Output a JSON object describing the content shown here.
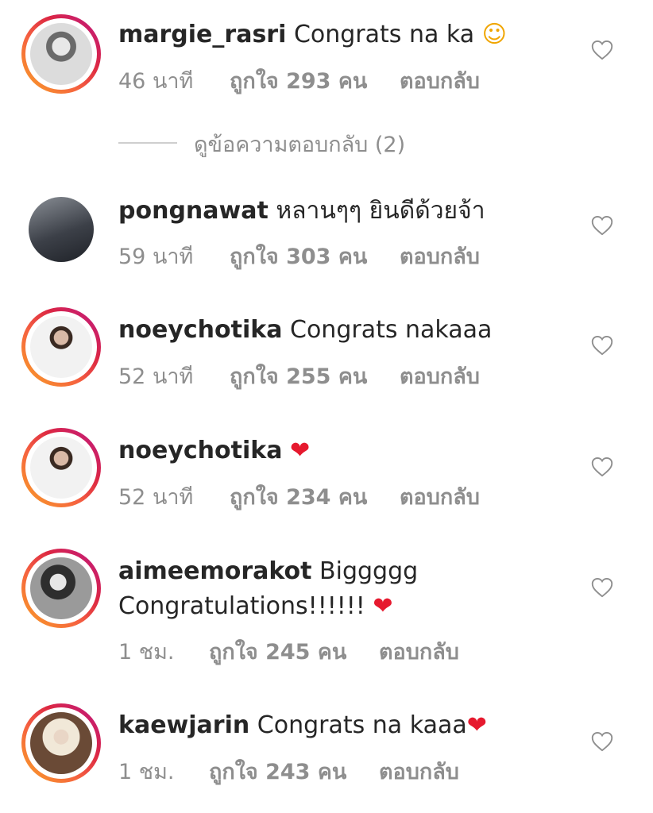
{
  "comments": [
    {
      "username": "margie_rasri",
      "text": "Congrats na ka",
      "emoji": "☺",
      "time": "46 นาที",
      "likes": "ถูกใจ 293 คน",
      "reply": "ตอบกลับ",
      "has_story_ring": true
    },
    {
      "username": "pongnawat",
      "text": "หลานๆๆ ยินดีด้วยจ้า",
      "emoji": "",
      "time": "59 นาที",
      "likes": "ถูกใจ 303 คน",
      "reply": "ตอบกลับ",
      "has_story_ring": false
    },
    {
      "username": "noeychotika",
      "text": "Congrats nakaaa",
      "emoji": "",
      "time": "52 นาที",
      "likes": "ถูกใจ 255 คน",
      "reply": "ตอบกลับ",
      "has_story_ring": true
    },
    {
      "username": "noeychotika",
      "text": "",
      "emoji": "❤",
      "time": "52 นาที",
      "likes": "ถูกใจ 234 คน",
      "reply": "ตอบกลับ",
      "has_story_ring": true
    },
    {
      "username": "aimeemorakot",
      "text": "Biggggg",
      "text_line2": "Congratulations!!!!!!",
      "emoji": "❤",
      "time": "1 ชม.",
      "likes": "ถูกใจ 245 คน",
      "reply": "ตอบกลับ",
      "has_story_ring": true
    },
    {
      "username": "kaewjarin",
      "text": "Congrats na kaaa",
      "emoji": "❤",
      "time": "1 ชม.",
      "likes": "ถูกใจ 243 คน",
      "reply": "ตอบกลับ",
      "has_story_ring": true
    }
  ],
  "view_replies": "ดูข้อความตอบกลับ (2)",
  "colors": {
    "meta_text": "#8e8e8e",
    "heart_emoji": "#e6192e",
    "ring_start": "#f9a326",
    "ring_end": "#bc1888"
  },
  "icons": {
    "like": "heart-outline-icon"
  }
}
